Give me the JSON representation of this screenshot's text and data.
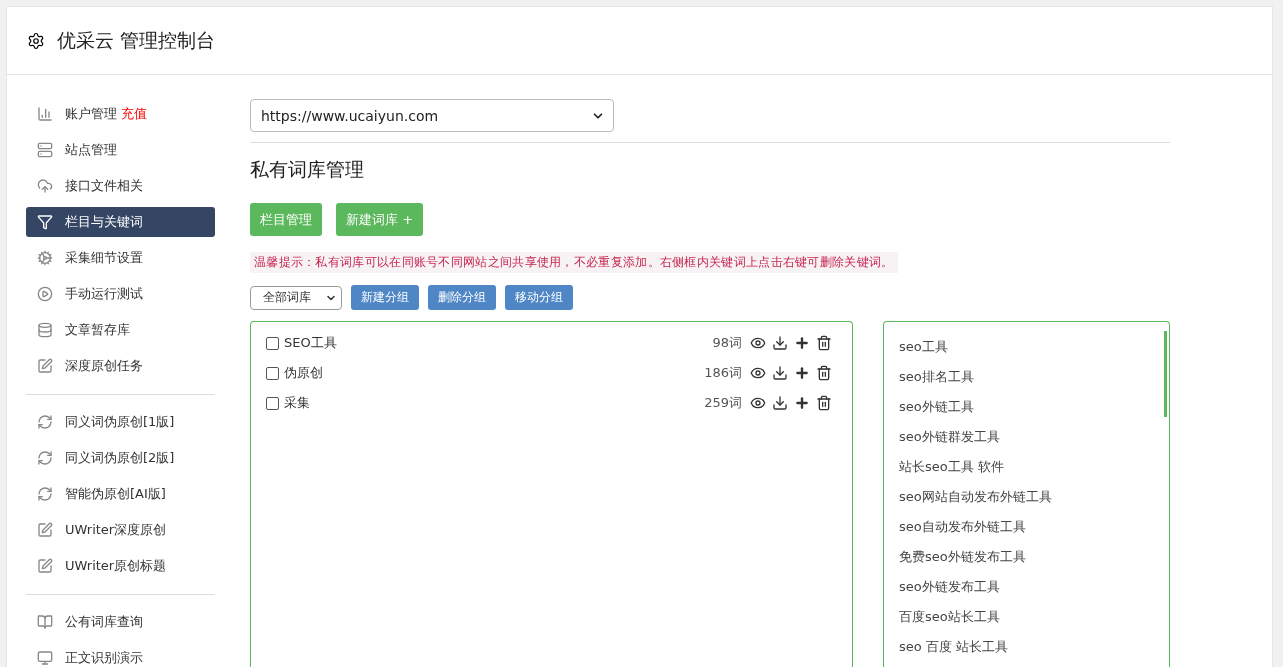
{
  "header": {
    "title": "优采云 管理控制台"
  },
  "sidebar": {
    "sections": [
      {
        "items": [
          {
            "label": "账户管理",
            "badge": "充值",
            "selected": false
          },
          {
            "label": "站点管理",
            "selected": false
          },
          {
            "label": "接口文件相关",
            "selected": false
          },
          {
            "label": "栏目与关键词",
            "selected": true
          },
          {
            "label": "采集细节设置",
            "selected": false
          },
          {
            "label": "手动运行测试",
            "selected": false
          },
          {
            "label": "文章暂存库",
            "selected": false
          },
          {
            "label": "深度原创任务",
            "selected": false
          }
        ]
      },
      {
        "items": [
          {
            "label": "同义词伪原创[1版]",
            "selected": false
          },
          {
            "label": "同义词伪原创[2版]",
            "selected": false
          },
          {
            "label": "智能伪原创[AI版]",
            "selected": false
          },
          {
            "label": "UWriter深度原创",
            "selected": false
          },
          {
            "label": "UWriter原创标题",
            "selected": false
          }
        ]
      },
      {
        "items": [
          {
            "label": "公有词库查询",
            "selected": false
          },
          {
            "label": "正文识别演示",
            "selected": false
          }
        ]
      }
    ]
  },
  "site_select": {
    "value": "https://www.ucaiyun.com"
  },
  "heading": "私有词库管理",
  "actions": [
    "栏目管理",
    "新建词库 +"
  ],
  "notice": "温馨提示：私有词库可以在同账号不同网站之间共享使用，不必重复添加。右侧框内关键词上点击右键可删除关键词。",
  "group_select": {
    "value": "全部词库"
  },
  "group_buttons": [
    "新建分组",
    "删除分组",
    "移动分组"
  ],
  "libraries": [
    {
      "name": "SEO工具",
      "count": "98词",
      "checked": false
    },
    {
      "name": "伪原创",
      "count": "186词",
      "checked": false
    },
    {
      "name": "采集",
      "count": "259词",
      "checked": false
    }
  ],
  "keywords": [
    "seo工具",
    "seo排名工具",
    "seo外链工具",
    "seo外链群发工具",
    "站长seo工具 软件",
    "seo网站自动发布外链工具",
    "seo自动发布外链工具",
    "免费seo外链发布工具",
    "seo外链发布工具",
    "百度seo站长工具",
    "seo 百度 站长工具"
  ]
}
